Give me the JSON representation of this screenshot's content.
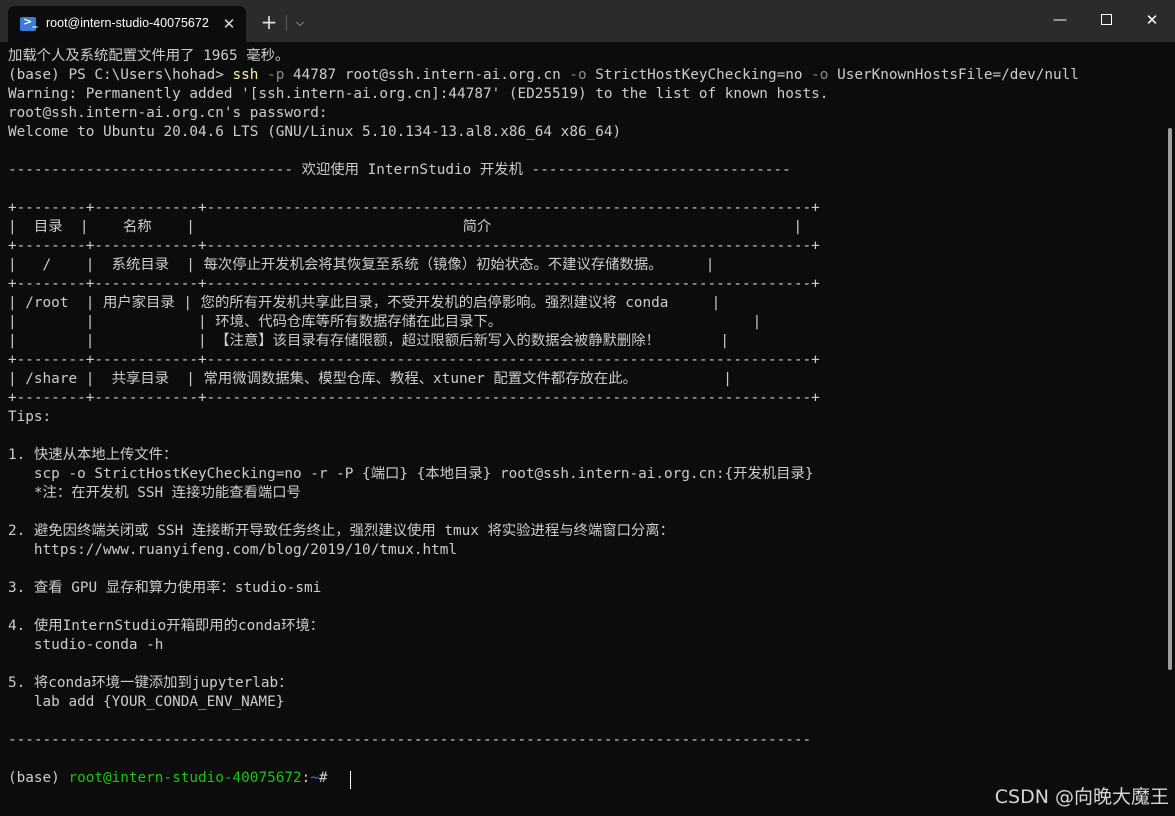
{
  "window": {
    "tab_title": "root@intern-studio-40075672",
    "tab_icon": "terminal-icon",
    "close_glyph": "✕",
    "new_tab_glyph": "+",
    "dropdown_glyph": "⌵",
    "minimize_glyph": "—",
    "close_window_glyph": "✕"
  },
  "terminal": {
    "l01": "加载个人及系统配置文件用了 1965 毫秒。",
    "l02_prompt": "(base) PS C:\\Users\\hohad> ",
    "l02_cmd": "ssh",
    "l02_a": " ",
    "l02_p": "-p",
    "l02_b": " 44787 root@ssh.intern-ai.org.cn ",
    "l02_o1": "-o",
    "l02_c": " StrictHostKeyChecking=no ",
    "l02_o2": "-o",
    "l02_d": " UserKnownHostsFile=/dev/null",
    "l03": "Warning: Permanently added '[ssh.intern-ai.org.cn]:44787' (ED25519) to the list of known hosts.",
    "l04": "root@ssh.intern-ai.org.cn's password:",
    "l05": "Welcome to Ubuntu 20.04.6 LTS (GNU/Linux 5.10.134-13.al8.x86_64 x86_64)",
    "l07": "--------------------------------- 欢迎使用 InternStudio 开发机 ------------------------------",
    "t01": "+--------+------------+----------------------------------------------------------------------+",
    "t02": "|  目录  |    名称    |                               简介                                   |",
    "t03": "+--------+------------+----------------------------------------------------------------------+",
    "t04": "|   /    |  系统目录  | 每次停止开发机会将其恢复至系统（镜像）初始状态。不建议存储数据。     |",
    "t05": "+--------+------------+----------------------------------------------------------------------+",
    "t06": "| /root  | 用户家目录 | 您的所有开发机共享此目录，不受开发机的启停影响。强烈建议将 conda     |",
    "t07": "|        |            | 环境、代码仓库等所有数据存储在此目录下。                             |",
    "t08": "|        |            | 【注意】该目录有存储限额，超过限额后新写入的数据会被静默删除！       |",
    "t09": "+--------+------------+----------------------------------------------------------------------+",
    "t10": "| /share |  共享目录  | 常用微调数据集、模型仓库、教程、xtuner 配置文件都存放在此。          |",
    "t11": "+--------+------------+----------------------------------------------------------------------+",
    "tips": "Tips:",
    "tip1": "1. 快速从本地上传文件：",
    "tip1a": "   scp -o StrictHostKeyChecking=no -r -P {端口} {本地目录} root@ssh.intern-ai.org.cn:{开发机目录}",
    "tip1b": "   *注：在开发机 SSH 连接功能查看端口号",
    "tip2": "2. 避免因终端关闭或 SSH 连接断开导致任务终止，强烈建议使用 tmux 将实验进程与终端窗口分离：",
    "tip2a": "   https://www.ruanyifeng.com/blog/2019/10/tmux.html",
    "tip3": "3. 查看 GPU 显存和算力使用率：studio-smi",
    "tip4": "4. 使用InternStudio开箱即用的conda环境：",
    "tip4a": "   studio-conda -h",
    "tip5": "5. 将conda环境一键添加到jupyterlab：",
    "tip5a": "   lab add {YOUR_CONDA_ENV_NAME}",
    "rule": "---------------------------------------------------------------------------------------------",
    "prompt_env": "(base) ",
    "prompt_user": "root@intern-studio-40075672",
    "prompt_sep": ":",
    "prompt_path": "~",
    "prompt_end": "# "
  },
  "watermark": "CSDN @向晚大魔王",
  "colors": {
    "background": "#0c0c0c",
    "titlebar": "#2b2b2b",
    "foreground": "#cccccc",
    "command": "#f9f1a5",
    "flag": "#8a8a8a",
    "prompt_user": "#16c60c",
    "prompt_path": "#3b78ff"
  }
}
